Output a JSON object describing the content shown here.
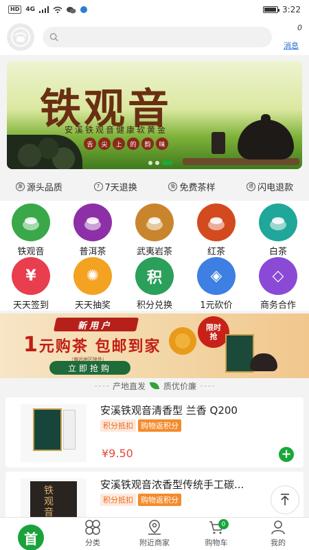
{
  "status_bar": {
    "hd": "HD",
    "network": "4G",
    "time": "3:22",
    "battery_level": 0.95
  },
  "header": {
    "search": {
      "value": "",
      "placeholder": ""
    },
    "message_count": "0",
    "message_label": "消息"
  },
  "banner": {
    "title": "铁观音",
    "subtitle": "安溪铁观音健康软黄金",
    "tagline": [
      "舌",
      "尖",
      "上",
      "的",
      "韵",
      "味"
    ],
    "slides": 3,
    "active_slide": 2
  },
  "guarantees": [
    {
      "icon": "certificate-icon",
      "label": "源头品质"
    },
    {
      "icon": "seven-day-icon",
      "label": "7天退换"
    },
    {
      "icon": "free-icon",
      "label": "免费茶样"
    },
    {
      "icon": "refund-icon",
      "label": "闪电退款"
    }
  ],
  "categories_row1": [
    {
      "label": "铁观音",
      "icon": "tieguanyin-icon",
      "color": "#3aa849"
    },
    {
      "label": "普洱茶",
      "icon": "puer-icon",
      "color": "#8d2fa6"
    },
    {
      "label": "武夷岩茶",
      "icon": "wuyi-icon",
      "color": "#c9852e"
    },
    {
      "label": "红茶",
      "icon": "black-tea-icon",
      "color": "#d24a1e"
    },
    {
      "label": "白茶",
      "icon": "white-tea-icon",
      "color": "#1fa79a"
    }
  ],
  "categories_row2": [
    {
      "label": "天天签到",
      "icon": "checkin-icon",
      "color": "#e83e4e",
      "glyph": "¥"
    },
    {
      "label": "天天抽奖",
      "icon": "lottery-icon",
      "color": "#f3a222",
      "glyph": "✺"
    },
    {
      "label": "积分兑换",
      "icon": "points-exchange-icon",
      "color": "#2aa05a",
      "glyph": "积"
    },
    {
      "label": "1元砍价",
      "icon": "bargain-icon",
      "color": "#3d7fe2",
      "glyph": "◈"
    },
    {
      "label": "商务合作",
      "icon": "cooperation-icon",
      "color": "#8a4ad6",
      "glyph": "◇"
    }
  ],
  "promo": {
    "badge_new": "新用户",
    "headline_num": "1",
    "headline": "元购茶 包邮到家",
    "note": "偏远地区除外",
    "button": "立即抢购",
    "limited_line1": "限时",
    "limited_line2": "抢"
  },
  "section": {
    "left": "产地直发",
    "right": "质优价廉"
  },
  "products": [
    {
      "title": "安溪铁观音清香型 兰香 Q200",
      "tag_points": "积分抵扣",
      "tag_rebate": "购物返积分",
      "price": "¥9.50"
    },
    {
      "title": "安溪铁观音浓香型传统手工碳...",
      "tag_points": "积分抵扣",
      "tag_rebate": "购物返积分",
      "box_text": "铁观音"
    }
  ],
  "bottom_nav": [
    {
      "label": "首",
      "icon": "home-icon"
    },
    {
      "label": "分类",
      "icon": "category-icon"
    },
    {
      "label": "附近商家",
      "icon": "location-icon"
    },
    {
      "label": "购物车",
      "icon": "cart-icon",
      "badge": "0"
    },
    {
      "label": "我的",
      "icon": "user-icon"
    }
  ]
}
